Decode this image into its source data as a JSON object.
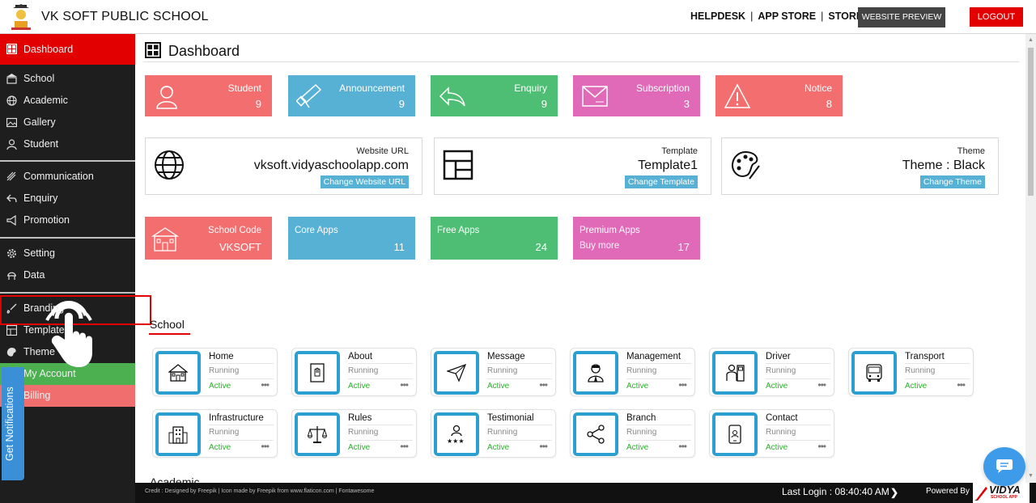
{
  "header": {
    "school_name": "VK SOFT PUBLIC SCHOOL",
    "links": [
      "HELPDESK",
      "APP STORE",
      "STORE"
    ],
    "preview_label": "WEBSITE PREVIEW",
    "logout_label": "LOGOUT"
  },
  "sidebar": {
    "items": [
      {
        "label": "Dashboard",
        "icon": "dashboard-icon"
      },
      {
        "label": "School",
        "icon": "school-icon"
      },
      {
        "label": "Academic",
        "icon": "globe-icon"
      },
      {
        "label": "Gallery",
        "icon": "image-icon"
      },
      {
        "label": "Student",
        "icon": "student-icon"
      },
      {
        "label": "Communication",
        "icon": "communication-icon"
      },
      {
        "label": "Enquiry",
        "icon": "reply-icon"
      },
      {
        "label": "Promotion",
        "icon": "megaphone-icon"
      },
      {
        "label": "Setting",
        "icon": "gear-icon"
      },
      {
        "label": "Data",
        "icon": "database-icon"
      },
      {
        "label": "Branding",
        "icon": "brush-icon"
      },
      {
        "label": "Template",
        "icon": "template-icon"
      },
      {
        "label": "Theme",
        "icon": "palette-icon"
      },
      {
        "label": "My Account",
        "icon": ""
      },
      {
        "label": "Billing",
        "icon": ""
      }
    ],
    "notification_label": "Get Notifications"
  },
  "main": {
    "title": "Dashboard",
    "stats": [
      {
        "label": "Student",
        "value": "9",
        "color": "#f36e6e",
        "icon": "student-icon"
      },
      {
        "label": "Announcement",
        "value": "9",
        "color": "#57b1d5",
        "icon": "megaphone-icon"
      },
      {
        "label": "Enquiry",
        "value": "9",
        "color": "#4dbe73",
        "icon": "reply-icon"
      },
      {
        "label": "Subscription",
        "value": "3",
        "color": "#e06ab7",
        "icon": "mail-icon"
      },
      {
        "label": "Notice",
        "value": "8",
        "color": "#f36e6e",
        "icon": "warning-icon"
      }
    ],
    "info": [
      {
        "label": "Website URL",
        "value": "vksoft.vidyaschoolapp.com",
        "button": "Change Website URL",
        "icon": "globe-icon"
      },
      {
        "label": "Template",
        "value": "Template1",
        "button": "Change Template",
        "icon": "template-icon"
      },
      {
        "label": "Theme",
        "value": "Theme : Black",
        "button": "Change Theme",
        "icon": "palette-icon"
      }
    ],
    "apps": [
      {
        "label": "School Code",
        "value": "VKSOFT",
        "sub": ""
      },
      {
        "label": "Core Apps",
        "value": "11",
        "sub": ""
      },
      {
        "label": "Free Apps",
        "value": "24",
        "sub": ""
      },
      {
        "label": "Premium Apps",
        "value": "17",
        "sub": "Buy more"
      }
    ],
    "section_school": "School",
    "section_next": "Academic",
    "modules": [
      {
        "name": "Home",
        "status": "Running",
        "state": "Active",
        "icon": "house-icon"
      },
      {
        "name": "About",
        "status": "Running",
        "state": "Active",
        "icon": "document-hand-icon"
      },
      {
        "name": "Message",
        "status": "Running",
        "state": "Active",
        "icon": "paper-plane-icon"
      },
      {
        "name": "Management",
        "status": "Running",
        "state": "Active",
        "icon": "manager-icon"
      },
      {
        "name": "Driver",
        "status": "Running",
        "state": "Active",
        "icon": "driver-icon"
      },
      {
        "name": "Transport",
        "status": "Running",
        "state": "Active",
        "icon": "bus-icon"
      },
      {
        "name": "Infrastructure",
        "status": "Running",
        "state": "Active",
        "icon": "building-icon"
      },
      {
        "name": "Rules",
        "status": "Running",
        "state": "Active",
        "icon": "scales-icon"
      },
      {
        "name": "Testimonial",
        "status": "Running",
        "state": "Active",
        "icon": "rating-icon"
      },
      {
        "name": "Branch",
        "status": "Running",
        "state": "Active",
        "icon": "share-icon"
      },
      {
        "name": "Contact",
        "status": "Running",
        "state": "Active",
        "icon": "phone-icon"
      }
    ],
    "more_label": "•••"
  },
  "footer": {
    "credit": "Credit : Designed by Freepik | Icon made by Freepik from www.flaticon.com | Fontawesome",
    "last_login": "Last Login : 08:40:40 AM",
    "powered_by": "Powered By",
    "brand": "VIDYA",
    "brand_sub": "SCHOOL APP"
  },
  "colors": {
    "accent_red": "#e30000",
    "sidebar_bg": "#1e1e1e",
    "module_border": "#2b9fd0"
  }
}
